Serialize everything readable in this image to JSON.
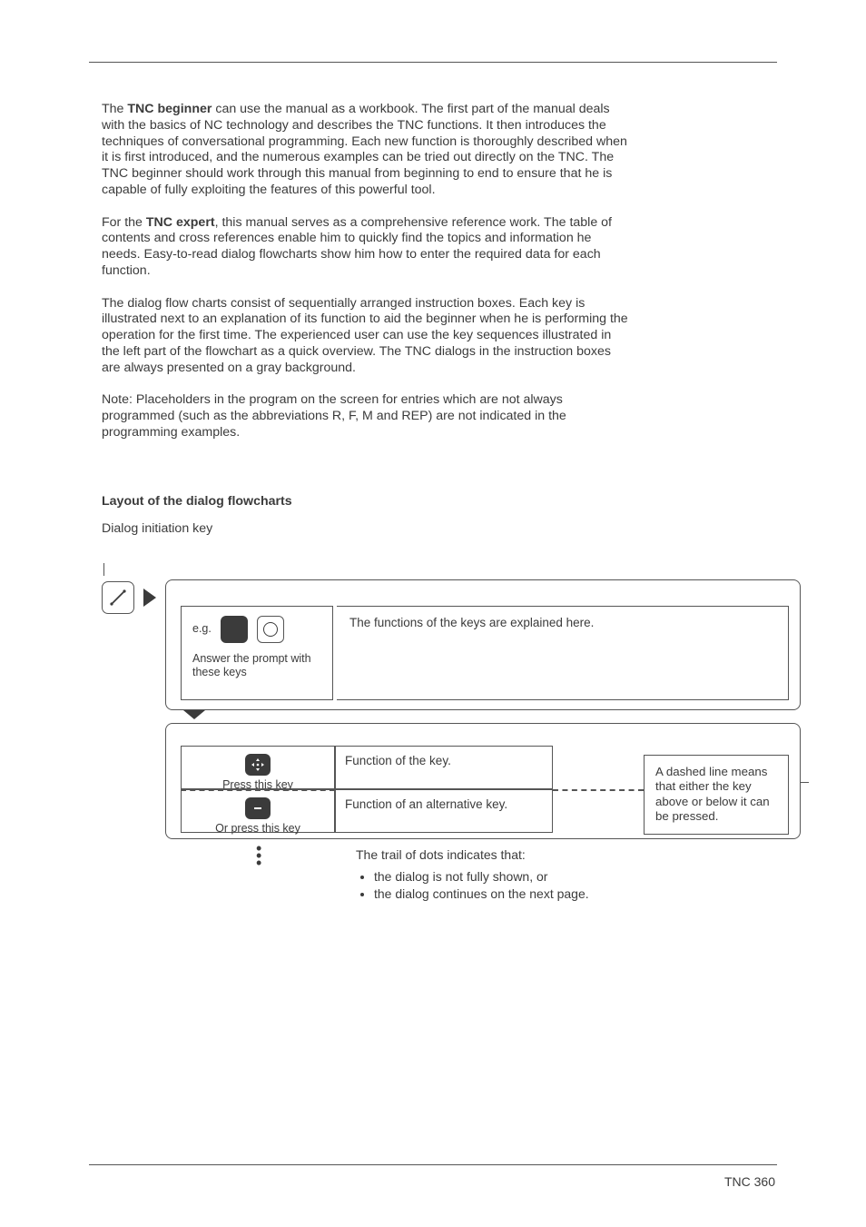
{
  "para1_pre": "The ",
  "para1_bold": "TNC beginner",
  "para1_post": " can use the manual as a workbook. The first part of the manual deals with the basics of NC technology and describes the TNC functions. It then introduces the techniques of conversational programming. Each new function is thoroughly described when it is first introduced, and the numerous examples can be tried out directly on the TNC. The TNC beginner should work through this manual from beginning to end to ensure that he is capable of fully exploiting the features of this powerful tool.",
  "para2_pre": "For the ",
  "para2_bold": "TNC expert",
  "para2_post": ", this manual serves as a comprehensive reference work. The table of contents and cross references enable him to quickly find the topics and information he needs. Easy-to-read dialog flowcharts show him how to enter the required data for each function.",
  "para3": "The dialog flow charts consist of sequentially arranged instruction boxes. Each key is illustrated next to an explanation of its function to aid the beginner when he is performing the operation for the first time. The experienced user can use the key sequences illustrated in the left part of the flowchart as a quick overview. The TNC dialogs in the instruction boxes are always presented on a gray background.",
  "para4": "Note: Placeholders in the program on the screen for entries which are not always programmed (such as the abbreviations R, F, M and REP) are not indicated in the programming examples.",
  "section_heading": "Layout of the dialog flowcharts",
  "dialog_init_label": "Dialog initiation key",
  "box1": {
    "eg": "e.g.",
    "answer_prompt": "Answer the prompt with these keys",
    "explain": "The functions of the keys are explained here."
  },
  "box2": {
    "press": "Press this key",
    "or_press": "Or press this key",
    "fn": "Function of the key.",
    "fn_alt": "Function of an alternative key.",
    "dashed_note": "A dashed line means that either the key above or below it can be pressed."
  },
  "trail": {
    "heading": "The trail of dots indicates that:",
    "b1": "the dialog is not fully shown, or",
    "b2": "the dialog continues on the next page."
  },
  "footer": "TNC 360"
}
